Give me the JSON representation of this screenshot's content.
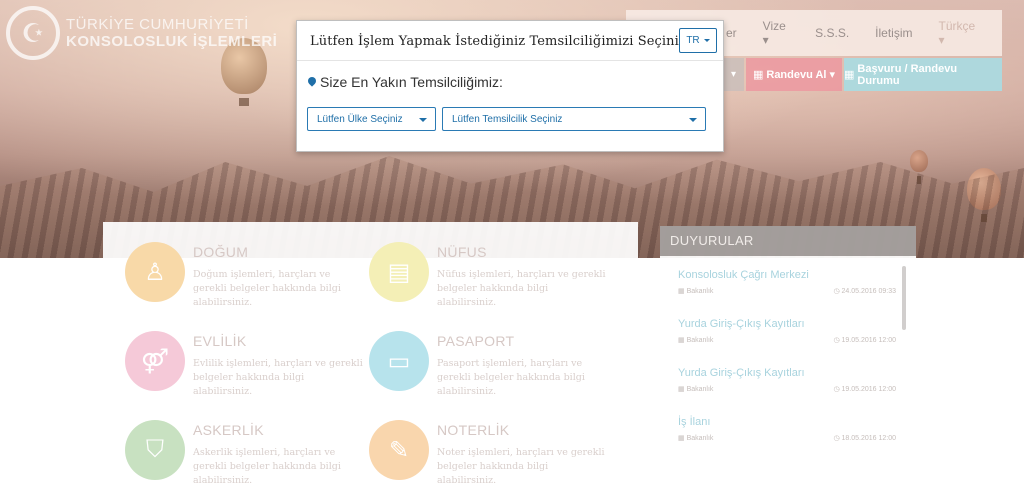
{
  "header": {
    "logo_line1": "TÜRKİYE CUMHURİYETİ",
    "logo_line2": "KONSOLOSLUK İŞLEMLERİ"
  },
  "topnav": {
    "items": [
      "er",
      "Vize ▾",
      "S.S.S.",
      "İletişim",
      "Türkçe ▾"
    ]
  },
  "actions": {
    "randevu_label": "Randevu Al",
    "basvuru_label": "Başvuru / Randevu Durumu"
  },
  "services": [
    {
      "title": "DOĞUM",
      "desc": "Doğum işlemleri, harçları ve gerekli belgeler hakkında bilgi alabilirsiniz.",
      "color": "#f8d9a8",
      "icon": "child-icon"
    },
    {
      "title": "NÜFUS",
      "desc": "Nüfus işlemleri, harçları ve gerekli belgeler hakkında bilgi alabilirsiniz.",
      "color": "#f4efb6",
      "icon": "document-icon"
    },
    {
      "title": "EVLİLİK",
      "desc": "Evlilik işlemleri, harçları ve gerekli belgeler hakkında bilgi alabilirsiniz.",
      "color": "#f5c9d8",
      "icon": "couple-icon"
    },
    {
      "title": "PASAPORT",
      "desc": "Pasaport işlemleri, harçları ve gerekli belgeler hakkında bilgi alabilirsiniz.",
      "color": "#b7e3ec",
      "icon": "passport-icon"
    },
    {
      "title": "ASKERLİK",
      "desc": "Askerlik işlemleri, harçları ve gerekli belgeler hakkında bilgi alabilirsiniz.",
      "color": "#c8e1c1",
      "icon": "shield-icon"
    },
    {
      "title": "NOTERLİK",
      "desc": "Noter işlemleri, harçları ve gerekli belgeler hakkında bilgi alabilirsiniz.",
      "color": "#f9d6ad",
      "icon": "pen-icon"
    }
  ],
  "duyurular": {
    "title": "DUYURULAR",
    "items": [
      {
        "title": "Konsolosluk Çağrı Merkezi",
        "source": "Bakanlık",
        "date": "24.05.2016 09:33"
      },
      {
        "title": "Yurda Giriş-Çıkış Kayıtları",
        "source": "Bakanlık",
        "date": "19.05.2016 12:00"
      },
      {
        "title": "Yurda Giriş-Çıkış Kayıtları",
        "source": "Bakanlık",
        "date": "19.05.2016 12:00"
      },
      {
        "title": "İş İlanı",
        "source": "Bakanlık",
        "date": "18.05.2016 12:00"
      }
    ]
  },
  "modal": {
    "title": "Lütfen İşlem Yapmak İstediğiniz Temsilciliğimizi Seçiniz",
    "lang_label": "TR",
    "nearest_label": "Size En Yakın Temsilciliğimiz:",
    "country_select": "Lütfen Ülke Seçiniz",
    "mission_select": "Lütfen Temsilcilik Seçiniz"
  }
}
